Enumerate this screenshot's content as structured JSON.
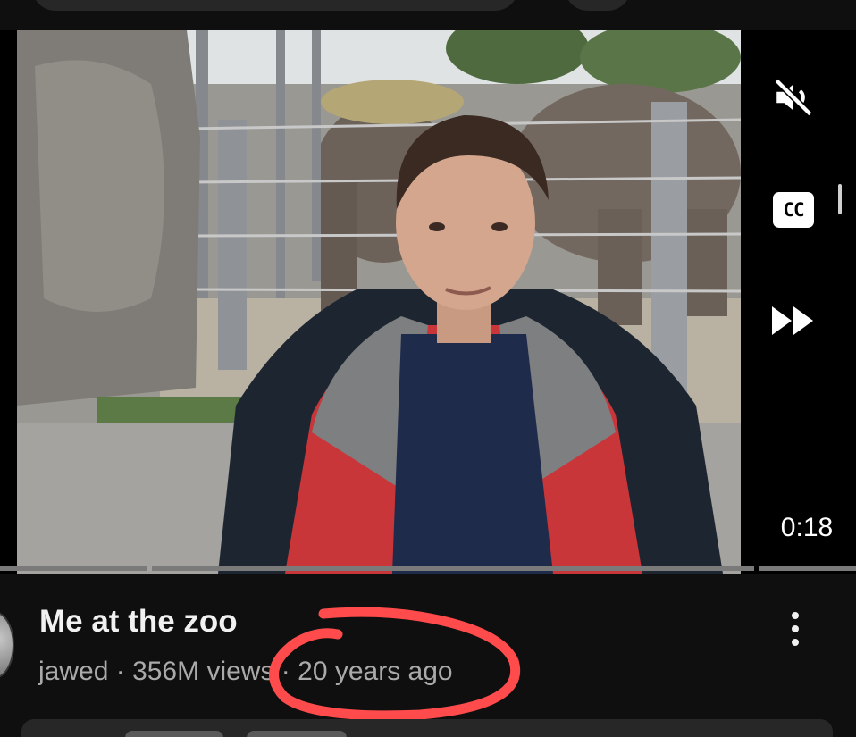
{
  "player": {
    "timestamp": "0:18",
    "progress_fraction": 0.18,
    "icons": {
      "mute": "mute-icon",
      "captions": "closed-captions-icon",
      "fast_forward": "fast-forward-icon"
    },
    "captions_label": "CC"
  },
  "video": {
    "title": "Me at the zoo",
    "channel": "jawed",
    "separator": " · ",
    "views": "356M views",
    "age": "20 years ago"
  },
  "menu": {
    "icon": "more-vertical-icon"
  },
  "colors": {
    "annotation": "#ff4b4b",
    "background": "#0f0f0f",
    "secondary_text": "#aaaaaa"
  }
}
